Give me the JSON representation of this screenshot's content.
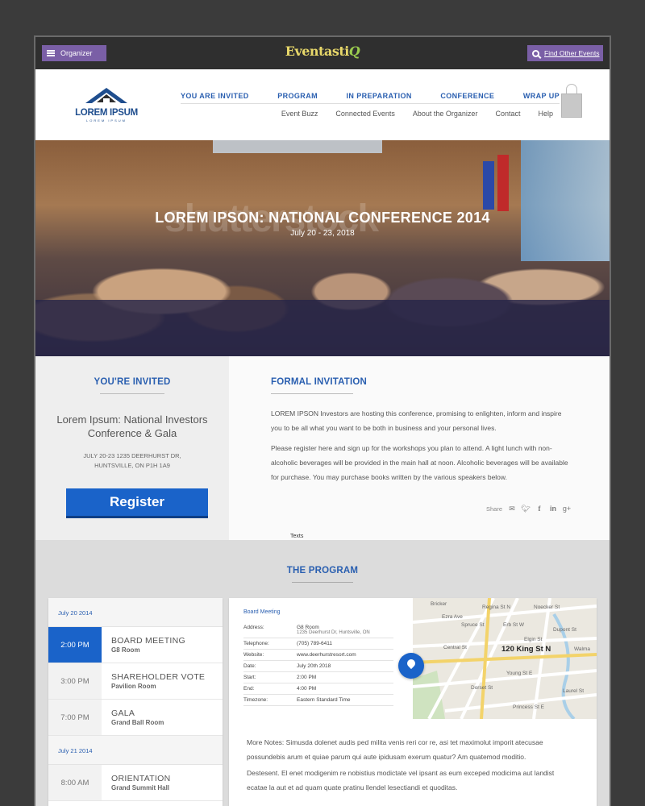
{
  "topbar": {
    "organizer_label": "Organizer",
    "logo_text": "Eventasti",
    "logo_suffix": "Q",
    "find_label": "Find Other Events"
  },
  "brand": {
    "name": "LOREM IPSUM",
    "tagline": "LOREM IPSUM"
  },
  "mainnav": [
    "YOU ARE INVITED",
    "PROGRAM",
    "IN PREPARATION",
    "CONFERENCE",
    "WRAP UP"
  ],
  "subnav": [
    "Event Buzz",
    "Connected Events",
    "About the Organizer",
    "Contact",
    "Help"
  ],
  "hero": {
    "watermark": "shutterstock",
    "title": "LOREM IPSON: NATIONAL CONFERENCE 2014",
    "date": "July 20 - 23, 2018"
  },
  "invite": {
    "left_title": "YOU'RE INVITED",
    "conference_name": "Lorem Ipsum: National Investors Conference & Gala",
    "address_line1": "JULY 20-23  1235 DEERHURST DR,",
    "address_line2": "HUNTSVILLE, ON P1H 1A9",
    "register_label": "Register",
    "right_title": "FORMAL INVITATION",
    "paragraph1": "LOREM IPSON Investors are hosting this conference, promising to enlighten, inform and inspire you to be all what you want to be both in business and your personal lives.",
    "paragraph2": "Please register here and sign up for the workshops you plan to attend. A light lunch with non-alcoholic beverages will be provided in the main hall at noon. Alcoholic beverages will be available for purchase. You may purchase books written by the various speakers below.",
    "share_label": "Share",
    "share_icons": [
      "mail-icon",
      "twitter-icon",
      "facebook-icon",
      "linkedin-icon",
      "googleplus-icon"
    ],
    "texts_label": "Texts"
  },
  "program": {
    "title": "THE PROGRAM",
    "days": [
      {
        "label": "July 20 2014",
        "slots": [
          {
            "time": "2:00 PM",
            "name": "BOARD MEETING",
            "room": "G8 Room"
          },
          {
            "time": "3:00 PM",
            "name": "SHAREHOLDER VOTE",
            "room": "Pavilion Room"
          },
          {
            "time": "7:00 PM",
            "name": "GALA",
            "room": "Grand Ball Room"
          }
        ]
      },
      {
        "label": "July 21 2014",
        "slots": [
          {
            "time": "8:00 AM",
            "name": "ORIENTATION",
            "room": "Grand Summit Hall"
          }
        ]
      }
    ],
    "detail": {
      "heading": "Board Meeting",
      "rows": [
        {
          "k": "Address:",
          "v": "G8 Room",
          "v2": "1235 Deerhurst Dr, Huntsville, ON"
        },
        {
          "k": "Telephone:",
          "v": "(705) 789-6411"
        },
        {
          "k": "Website:",
          "v": "www.deerhurstresort.com"
        },
        {
          "k": "Date:",
          "v": "July 20th 2018"
        },
        {
          "k": "Start:",
          "v": "2:00 PM"
        },
        {
          "k": "End:",
          "v": "4:00 PM"
        },
        {
          "k": "Timezone:",
          "v": "Eastern Standard Time"
        }
      ],
      "map_address": "120 King St N",
      "map_streets": [
        "Erb St W",
        "Elgin St",
        "Central St",
        "Young St E",
        "Dorset St",
        "Princess St E",
        "Noecker St",
        "Walma",
        "Laurel St",
        "Ezra Ave",
        "Bricker",
        "Spruce St",
        "Regina St N",
        "Dupont St"
      ],
      "notes1": "More Notes: Simusda dolenet audis ped milita venis reri cor re, asi tet maximolut imporit atecusae possundebis arum et quiae parum qui aute ipidusam exerum quatur? Am quatemod moditio.",
      "notes2": "Destesent. El enet modigenim re nobistius modictate vel ipsant as eum exceped modicima aut landist ecatae la aut et ad quam quate pratinu llendel lesectiandi et quoditas."
    }
  },
  "colors": {
    "accent_purple": "#7a5fa6",
    "link_blue": "#2a5fb0",
    "register_blue": "#1a63c9"
  }
}
